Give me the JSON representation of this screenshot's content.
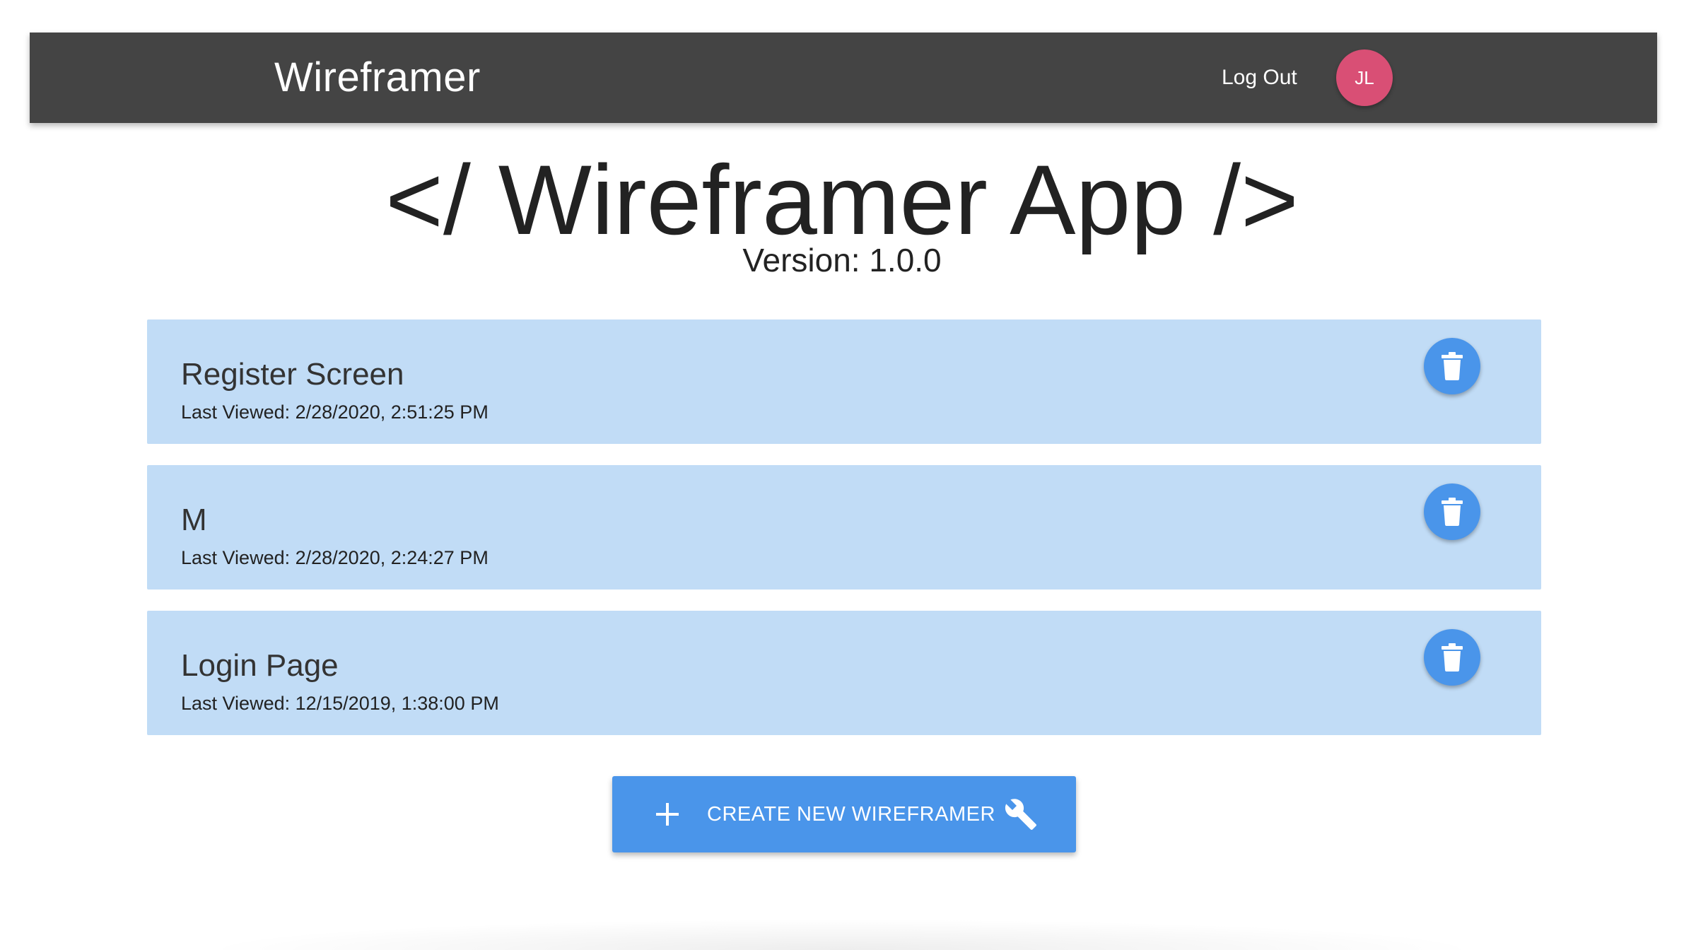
{
  "navbar": {
    "brand": "Wireframer",
    "logout_label": "Log Out",
    "avatar_initials": "JL",
    "background_color": "#444444",
    "avatar_color": "#d94f75"
  },
  "header": {
    "title": "</ Wireframer App />",
    "version": "Version: 1.0.0"
  },
  "wireframes": [
    {
      "name": "Register Screen",
      "last_viewed": "Last Viewed: 2/28/2020, 2:51:25 PM",
      "delete_icon": "trash-icon"
    },
    {
      "name": "M",
      "last_viewed": "Last Viewed: 2/28/2020, 2:24:27 PM",
      "delete_icon": "trash-icon"
    },
    {
      "name": "Login Page",
      "last_viewed": "Last Viewed: 12/15/2019, 1:38:00 PM",
      "delete_icon": "trash-icon"
    }
  ],
  "create_button": {
    "label": "CREATE NEW WIREFRAMER",
    "left_icon": "plus-icon",
    "right_icon": "wrench-icon"
  },
  "colors": {
    "card_background": "#c1dcf6",
    "accent_blue": "#4a95ea"
  }
}
